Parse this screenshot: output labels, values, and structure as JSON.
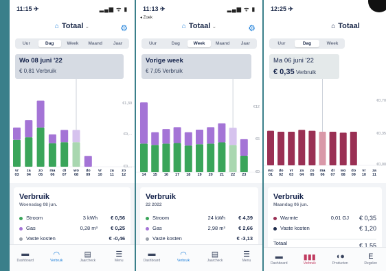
{
  "screens": [
    {
      "status": {
        "time": "11:15 ✈",
        "icons": "▂▄▆ ᯤ ▮"
      },
      "header": {
        "title": "Totaal",
        "chevron": "⌄"
      },
      "tabs": [
        "Uur",
        "Dag",
        "Week",
        "Maand",
        "Jaar"
      ],
      "active_tab": "Dag",
      "info": {
        "title": "Wo 08 juni '22",
        "value": "€ 0,81",
        "unit": "Verbruik"
      },
      "axis_labels": [
        "€1,30",
        "€0,...",
        "€0,..."
      ],
      "chart_data": {
        "type": "bar",
        "categories": [
          "vr 03",
          "za 04",
          "zo 05",
          "ma 06",
          "di 07",
          "wo 08",
          "do 09",
          "vr 10",
          "za 11",
          "zo 12"
        ],
        "x_labels_top": [
          "vr",
          "za",
          "zo",
          "ma",
          "di",
          "wo",
          "do",
          "vr",
          "za",
          "zo"
        ],
        "x_labels_bottom": [
          "03",
          "04",
          "05",
          "06",
          "07",
          "08",
          "09",
          "10",
          "11",
          "12"
        ],
        "series": [
          {
            "name": "Stroom",
            "values": [
              0.55,
              0.6,
              0.8,
              0.48,
              0.5,
              0.5,
              0.0,
              0.0,
              0.0,
              0.0
            ]
          },
          {
            "name": "Gas",
            "values": [
              0.25,
              0.35,
              0.55,
              0.18,
              0.25,
              0.25,
              0.22,
              0.0,
              0.0,
              0.0
            ]
          }
        ],
        "ylim": [
          0,
          1.4
        ],
        "selected_index": 5
      },
      "card": {
        "title": "Verbruik",
        "date": "Woensdag 08 jun.",
        "rows": [
          {
            "label": "Stroom",
            "amount": "3 kWh",
            "cost": "€ 0,56",
            "color": "#3aa55a"
          },
          {
            "label": "Gas",
            "amount": "0,28 m³",
            "cost": "€ 0,25",
            "color": "#a474d6"
          },
          {
            "label": "Vaste kosten",
            "amount": "",
            "cost": "€ -0,46",
            "color": "#9aa0aa"
          }
        ]
      },
      "nav": [
        "Dashboard",
        "Verbruik",
        "Jaarcheck",
        "Menu"
      ]
    },
    {
      "status": {
        "time": "11:13 ✈",
        "back": "◂ Zoek",
        "icons": "▂▄▆ ᯤ ▮"
      },
      "header": {
        "title": "Totaal",
        "chevron": "⌄"
      },
      "tabs": [
        "Uur",
        "Dag",
        "Week",
        "Maand",
        "Jaar"
      ],
      "active_tab": "Week",
      "info": {
        "title": "Vorige week",
        "value": "€ 7,05",
        "unit": "Verbruik"
      },
      "axis_labels": [
        "€12",
        "€6",
        "€0"
      ],
      "chart_data": {
        "type": "bar",
        "categories": [
          "14",
          "15",
          "16",
          "17",
          "18",
          "19",
          "20",
          "21",
          "22",
          "23"
        ],
        "series": [
          {
            "name": "Stroom",
            "values": [
              4.5,
              4.3,
              4.5,
              4.6,
              4.2,
              4.4,
              4.5,
              4.7,
              4.3,
              2.6
            ]
          },
          {
            "name": "Gas",
            "values": [
              6.5,
              2.0,
              2.3,
              2.5,
              2.1,
              2.3,
              2.6,
              3.0,
              2.7,
              2.6
            ]
          }
        ],
        "ylim": [
          0,
          12
        ],
        "selected_index": 8
      },
      "card": {
        "title": "Verbruik",
        "date": "22 2022",
        "rows": [
          {
            "label": "Stroom",
            "amount": "24 kWh",
            "cost": "€ 4,39",
            "color": "#3aa55a"
          },
          {
            "label": "Gas",
            "amount": "2,98 m³",
            "cost": "€ 2,66",
            "color": "#a474d6"
          },
          {
            "label": "Vaste kosten",
            "amount": "",
            "cost": "€ -3,13",
            "color": "#9aa0aa"
          }
        ]
      },
      "nav": [
        "Dashboard",
        "Verbruik",
        "Jaarcheck",
        "Menu"
      ]
    },
    {
      "status": {
        "time": "12:25 ✈"
      },
      "header": {
        "title": "Totaal"
      },
      "tabs": [
        "Uur",
        "Dag",
        "Week"
      ],
      "active_tab": "Dag",
      "info": {
        "title": "Ma 06 juni '22",
        "value": "€ 0,35",
        "unit": "Verbruik"
      },
      "axis_labels": [
        "€0,70",
        "€0,35",
        "€0,00"
      ],
      "chart_data": {
        "type": "bar",
        "categories": [
          "wo 01",
          "do 02",
          "vr 03",
          "za 04",
          "zo 05",
          "ma 06",
          "di 07",
          "wo 08",
          "do 09",
          "vr 10",
          "za 11"
        ],
        "x_labels_top": [
          "wo",
          "do",
          "vr",
          "za",
          "zo",
          "ma",
          "di",
          "wo",
          "do",
          "vr",
          "za"
        ],
        "x_labels_bottom": [
          "01",
          "02",
          "03",
          "04",
          "05",
          "06",
          "07",
          "08",
          "09",
          "10",
          "11"
        ],
        "series": [
          {
            "name": "Warmte",
            "values": [
              0.36,
              0.35,
              0.35,
              0.37,
              0.36,
              0.35,
              0.35,
              0.34,
              0.35,
              0.0,
              0.0
            ]
          }
        ],
        "ylim": [
          0,
          0.7
        ],
        "selected_index": 5
      },
      "card": {
        "title": "Verbruik",
        "date": "Maandag 06 jun.",
        "rows": [
          {
            "label": "Warmte",
            "amount": "0,01 GJ",
            "cost": "€ 0,35",
            "color": "#9a3054"
          },
          {
            "label": "Vaste kosten",
            "amount": "",
            "cost": "€ 1,20",
            "color": "#1c2a4a"
          }
        ],
        "total_label": "Totaal",
        "total_value": "€ 1,55"
      },
      "nav": [
        "Dashboard",
        "Verbruik",
        "Producten",
        "Regelen"
      ]
    }
  ],
  "colors": {
    "stroom": "#3aa55a",
    "stroom_light": "#a9d7b0",
    "gas": "#a474d6",
    "gas_light": "#d6c3ee",
    "warmte": "#9a3054",
    "warmte_light": "#d998a8",
    "accent": "#1d7fd9"
  }
}
